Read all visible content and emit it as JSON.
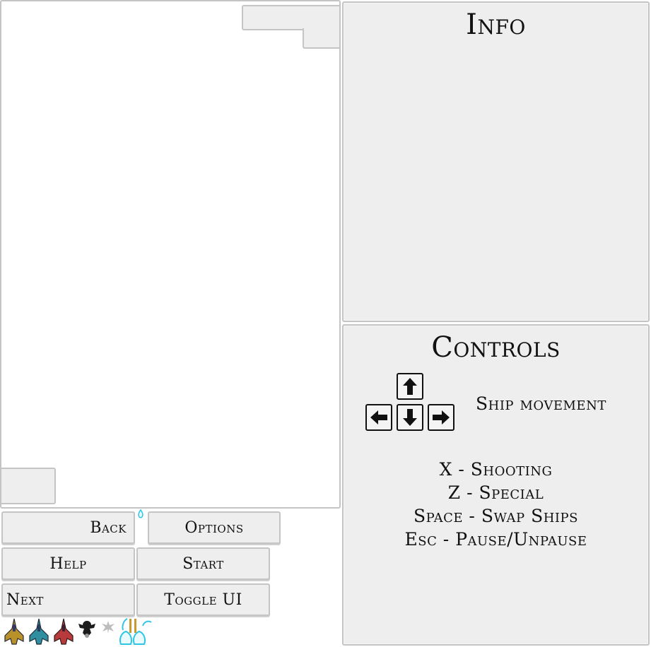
{
  "game": {
    "playfield": "",
    "score_box": ""
  },
  "buttons": {
    "back": "Back",
    "options": "Options",
    "help": "Help",
    "start": "Start",
    "next": "Next",
    "toggle_ui": "Toggle UI"
  },
  "info": {
    "title": "Info"
  },
  "controls": {
    "title": "Controls",
    "arrows_label": "Ship movement",
    "lines": [
      "X - Shooting",
      "Z - Special",
      "Space - Swap Ships",
      "Esc - Pause/Unpause"
    ]
  },
  "icons": {
    "arrow_keys": [
      "arrow-up-icon",
      "arrow-left-icon",
      "arrow-down-icon",
      "arrow-right-icon"
    ],
    "sprites": [
      "ship-gold-icon",
      "ship-teal-icon",
      "ship-red-icon",
      "enemy-black-icon",
      "enemy-grey-icon",
      "projectile-cyan-icon"
    ]
  },
  "colors": {
    "panel": "#eeeeee",
    "border": "#c4c4c4",
    "accent_cyan": "#2ec6e8"
  }
}
